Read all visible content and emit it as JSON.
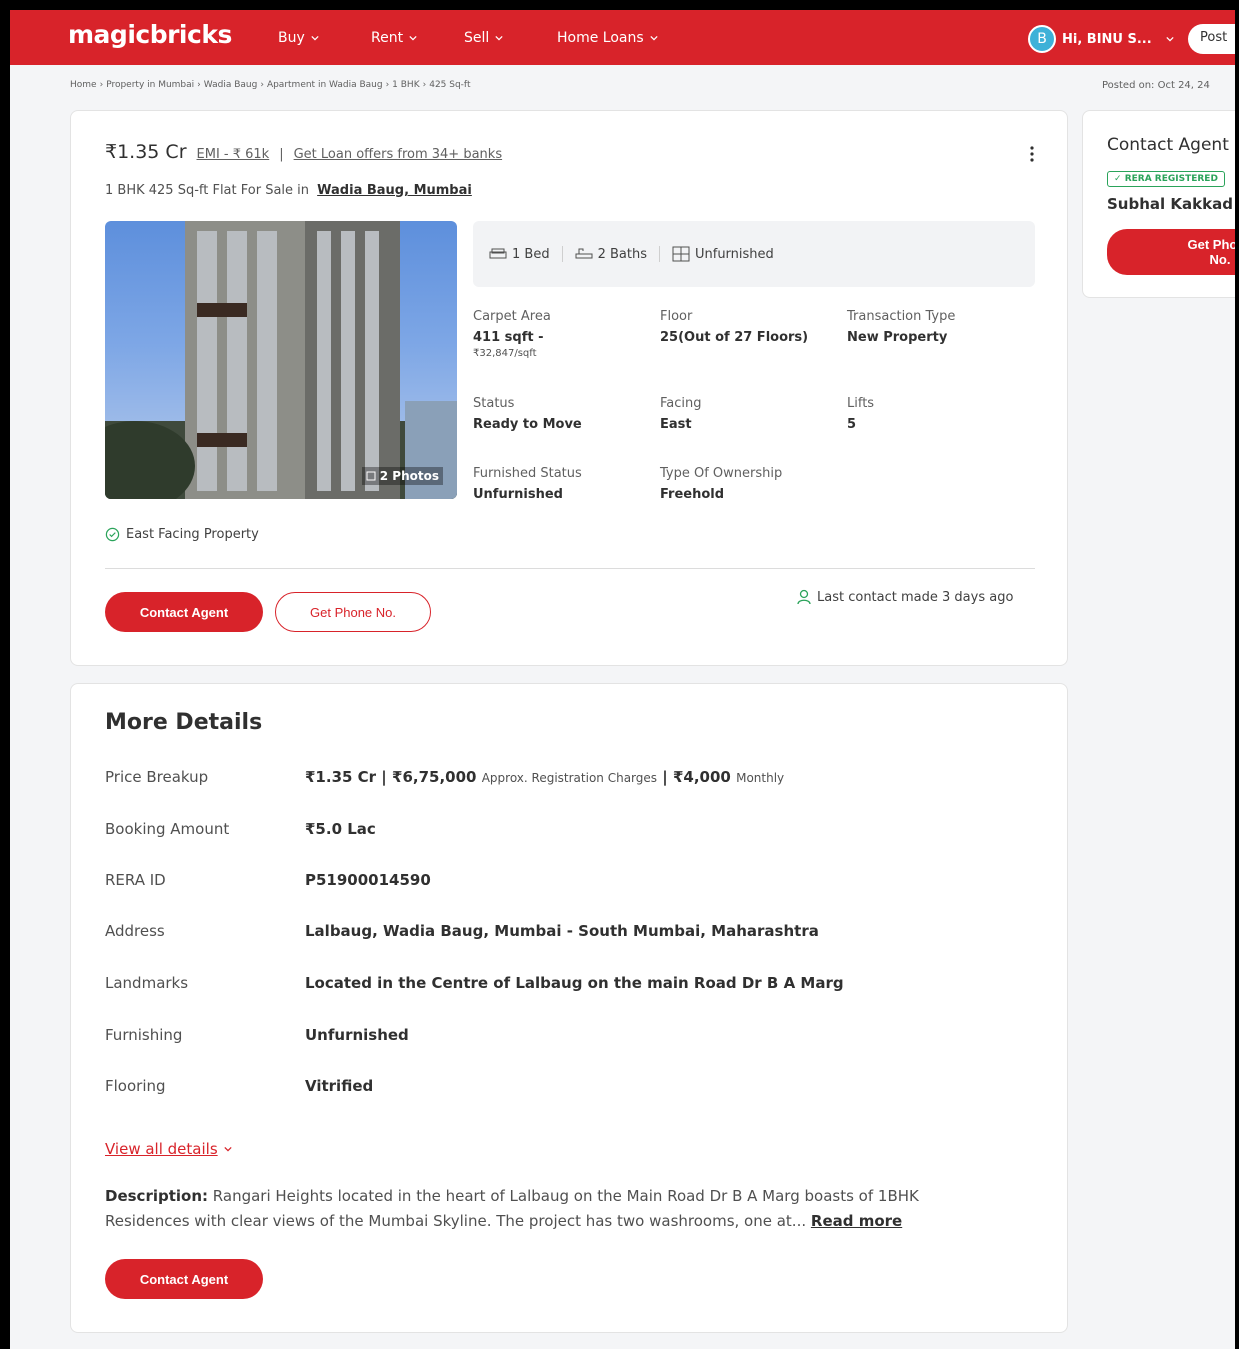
{
  "header": {
    "logo": "magicbricks",
    "nav": [
      "Buy",
      "Rent",
      "Sell",
      "Home Loans"
    ],
    "user_initial": "B",
    "user_greeting": "Hi, BINU S...",
    "post_label": "Post"
  },
  "breadcrumb": [
    "Home",
    "Property in Mumbai",
    "Wadia Baug",
    "Apartment in Wadia Baug",
    "1 BHK",
    "425 Sq-ft"
  ],
  "posted_on": "Posted on: Oct 24, 24",
  "listing": {
    "price": "₹1.35 Cr",
    "emi": "EMI - ₹ 61k",
    "separator": "|",
    "loan_offer": "Get Loan offers from 34+ banks",
    "subtitle": "1 BHK 425 Sq-ft Flat For Sale in",
    "location_link": "Wadia Baug, Mumbai",
    "photos_badge": "2 Photos",
    "amenities": [
      "1 Bed",
      "2 Baths",
      "Unfurnished"
    ],
    "specs": {
      "carpet_area_label": "Carpet Area",
      "carpet_area_value": "411 sqft -",
      "carpet_area_rate": "₹32,847/sqft",
      "floor_label": "Floor",
      "floor_value": "25(Out of 27 Floors)",
      "transaction_label": "Transaction Type",
      "transaction_value": "New Property",
      "status_label": "Status",
      "status_value": "Ready to Move",
      "facing_label": "Facing",
      "facing_value": "East",
      "lifts_label": "Lifts",
      "lifts_value": "5",
      "furnished_label": "Furnished Status",
      "furnished_value": "Unfurnished",
      "ownership_label": "Type Of Ownership",
      "ownership_value": "Freehold"
    },
    "highlight": "East Facing Property",
    "contact_button": "Contact Agent",
    "phone_button": "Get Phone No.",
    "last_contact": "Last contact made 3 days ago"
  },
  "more_details": {
    "title": "More Details",
    "price_breakup_label": "Price Breakup",
    "price_breakup_price": "₹1.35 Cr",
    "price_breakup_reg": "₹6,75,000",
    "price_breakup_reg_note": "Approx. Registration Charges",
    "price_breakup_monthly": "₹4,000",
    "price_breakup_monthly_note": "Monthly",
    "rows": [
      {
        "key": "Booking Amount",
        "value": "₹5.0 Lac"
      },
      {
        "key": "RERA ID",
        "value": "P51900014590"
      },
      {
        "key": "Address",
        "value": "Lalbaug, Wadia Baug, Mumbai - South Mumbai, Maharashtra"
      },
      {
        "key": "Landmarks",
        "value": "Located in the Centre of Lalbaug on the main Road Dr B A Marg"
      },
      {
        "key": "Furnishing",
        "value": "Unfurnished"
      },
      {
        "key": "Flooring",
        "value": "Vitrified"
      }
    ],
    "view_all": "View all details",
    "description_label": "Description:",
    "description": "Rangari Heights located in the heart of Lalbaug on the Main Road Dr B A Marg boasts of 1BHK Residences with clear views of the Mumbai Skyline. The project has two washrooms, one at...",
    "read_more": "Read more",
    "contact_button": "Contact Agent"
  },
  "side": {
    "title": "Contact Agent",
    "rera_badge": "RERA REGISTERED",
    "agent_name": "Subhal Kakkad",
    "button": "Get Phone No."
  },
  "colors": {
    "brand": "#d8232a",
    "success": "#2aa35a"
  }
}
